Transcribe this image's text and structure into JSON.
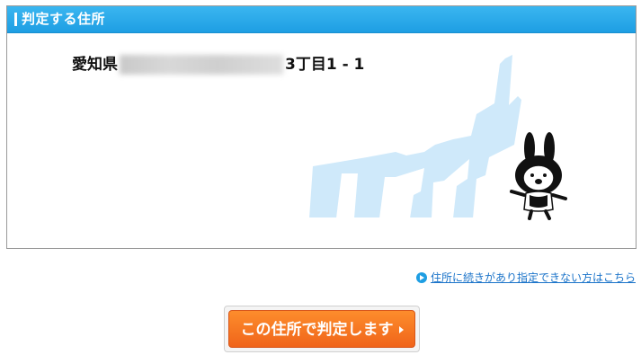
{
  "panel": {
    "title": "判定する住所"
  },
  "address": {
    "prefix": "愛知県",
    "suffix": "3丁目1 - 1"
  },
  "help_link": {
    "label": "住所に続きがあり指定できない方はこちら"
  },
  "submit": {
    "label": "この住所で判定します"
  },
  "colors": {
    "header": "#1e9ee3",
    "button": "#f0641a",
    "map": "#cfe9fa",
    "link": "#1a73c9"
  }
}
